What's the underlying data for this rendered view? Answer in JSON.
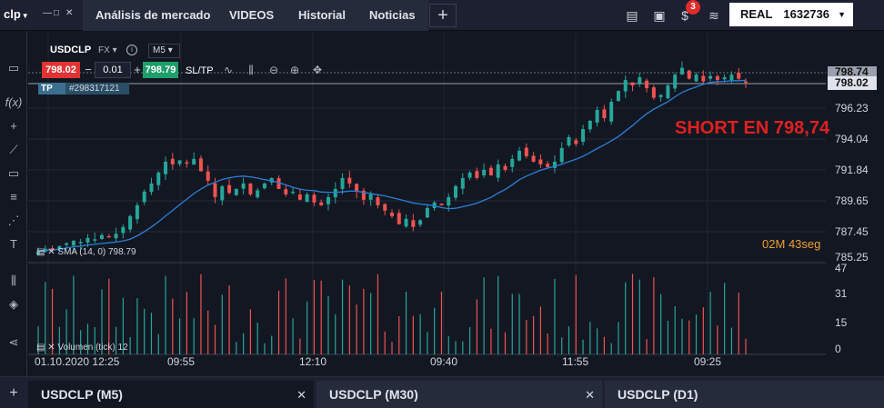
{
  "header": {
    "logo": "clp",
    "tabs": [
      "Análisis de mercado",
      "VIDEOS",
      "Historial",
      "Noticias"
    ],
    "notification_count": "3",
    "account_type": "REAL",
    "account_number": "1632736"
  },
  "instrument": {
    "symbol": "USDCLP",
    "market": "FX",
    "timeframe": "M5",
    "sell_price": "798.02",
    "lot": "0.01",
    "buy_price": "798.79",
    "sltp_label": "SL/TP",
    "tp_label": "TP",
    "order_id": "#298317121"
  },
  "annotation": "SHORT EN 798,74",
  "countdown": {
    "minutes": "02",
    "min_unit": "M",
    "seconds": "43",
    "sec_unit": "seg"
  },
  "indicators": {
    "sma_label": "SMA (14, 0) 798.79",
    "volume_label": "Volumen (tick) 12"
  },
  "price_axis": {
    "ticks": [
      "796.23",
      "794.04",
      "791.84",
      "789.65",
      "787.45",
      "785.25"
    ],
    "current_price": "798.02",
    "open_price": "798.74"
  },
  "volume_axis": {
    "ticks": [
      "47",
      "31",
      "15",
      "0"
    ]
  },
  "time_axis": {
    "ticks": [
      "01.10.2020 12:25",
      "09:55",
      "12:10",
      "09:40",
      "11:55",
      "09:25"
    ]
  },
  "bottom_tabs": [
    {
      "label": "USDCLP (M5)"
    },
    {
      "label": "USDCLP (M30)"
    },
    {
      "label": "USDCLP (D1)"
    }
  ],
  "colors": {
    "up": "#26a69a",
    "down": "#ef5350",
    "sma": "#2b7fd6",
    "background": "#131722"
  },
  "chart_data": {
    "type": "candlestick",
    "symbol": "USDCLP",
    "timeframe": "M5",
    "ylim": [
      785.25,
      798.74
    ],
    "closes": [
      785.6,
      785.8,
      785.7,
      786.0,
      786.2,
      786.4,
      786.3,
      786.6,
      786.5,
      786.8,
      786.7,
      786.9,
      787.4,
      788.2,
      789.0,
      790.0,
      790.6,
      791.4,
      792.2,
      792.0,
      792.3,
      792.1,
      792.4,
      791.5,
      790.8,
      789.6,
      790.4,
      789.9,
      790.2,
      790.6,
      789.8,
      790.1,
      790.6,
      791.0,
      790.2,
      789.8,
      790.0,
      789.4,
      789.8,
      789.2,
      789.0,
      789.6,
      790.2,
      791.0,
      790.6,
      790.0,
      789.4,
      789.8,
      789.0,
      788.6,
      788.2,
      787.6,
      788.0,
      787.4,
      787.9,
      788.8,
      789.2,
      789.0,
      789.6,
      790.4,
      791.0,
      791.4,
      791.0,
      791.6,
      791.2,
      792.0,
      791.6,
      792.4,
      793.0,
      792.6,
      792.2,
      792.0,
      791.8,
      792.2,
      793.2,
      794.0,
      793.5,
      794.6,
      795.2,
      796.0,
      795.4,
      796.6,
      797.4,
      798.2,
      797.8,
      798.4,
      797.6,
      796.9,
      797.1,
      797.8,
      798.6,
      799.1,
      798.3,
      798.6,
      798.1,
      798.5,
      798.2,
      798.4,
      798.6,
      798.3,
      798.0
    ]
  }
}
